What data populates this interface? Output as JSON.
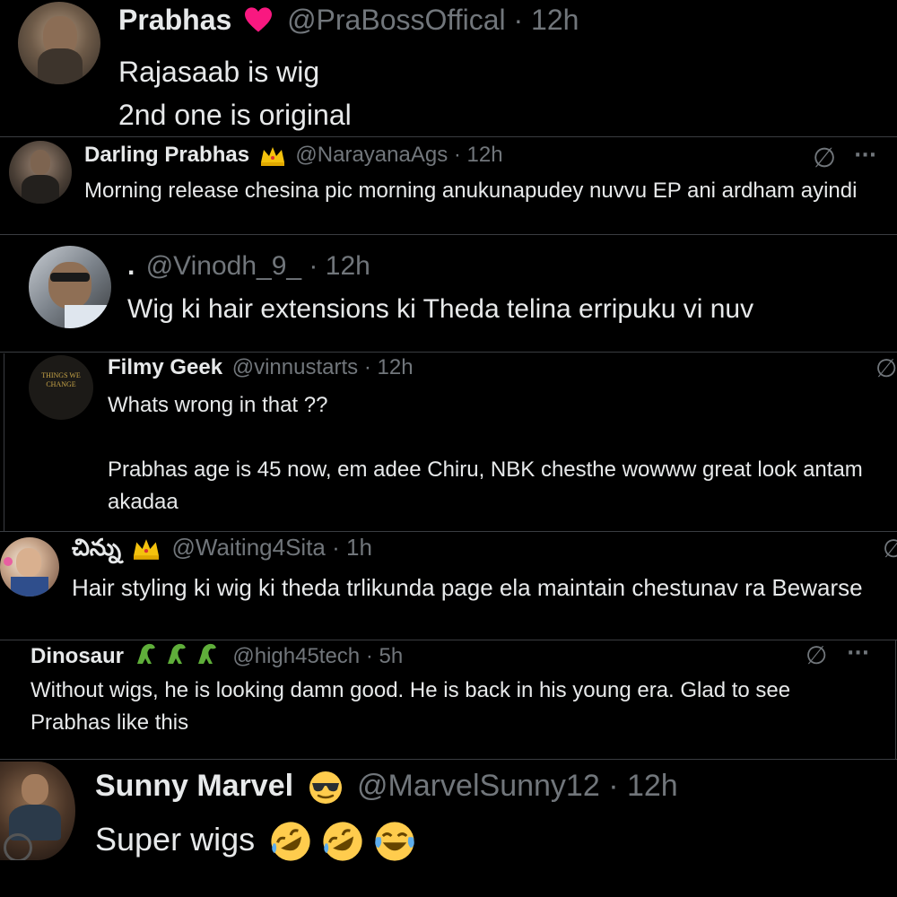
{
  "tweets": [
    {
      "name": "Prabhas",
      "handle": "@PraBossOffical",
      "time": "12h",
      "sep": "·",
      "lines": [
        "Rajasaab is wig",
        "2nd one is original"
      ]
    },
    {
      "name": "Darling Prabhas",
      "handle": "@NarayanaAgs",
      "time": "12h",
      "sep": "·",
      "text": "Morning release chesina pic morning anukunapudey nuvvu EP ani ardham ayindi"
    },
    {
      "name": ".",
      "handle": "@Vinodh_9_",
      "time": "12h",
      "sep": "·",
      "text": "Wig ki hair extensions ki Theda telina erripuku vi nuv"
    },
    {
      "name": "Filmy Geek",
      "handle": "@vinnustarts",
      "time": "12h",
      "sep": "·",
      "lines": [
        "Whats wrong in that ??",
        "",
        "Prabhas age is 45 now, em adee Chiru, NBK chesthe wowww great look antam akadaa"
      ],
      "avatar_text": "THINGS WE CHANGE"
    },
    {
      "name": "చిన్ను",
      "handle": "@Waiting4Sita",
      "time": "1h",
      "sep": "·",
      "text": "Hair styling ki wig ki theda trlikunda page ela maintain chestunav ra Bewarse"
    },
    {
      "name": "Dinosaur",
      "handle": "@high45tech",
      "time": "5h",
      "sep": "·",
      "text": "Without wigs, he is looking damn good. He is back in his young era. Glad to see Prabhas like this"
    },
    {
      "name": "Sunny Marvel",
      "handle": "@MarvelSunny12",
      "time": "12h",
      "sep": "·",
      "text": "Super wigs"
    }
  ],
  "icons": {
    "grok": "∅",
    "more": "···"
  },
  "colors": {
    "bg": "#000000",
    "text": "#e7e9ea",
    "muted": "#71767b",
    "heart": "#f91880",
    "gold": "#f4c20d",
    "emoji": "#ffcc4d"
  }
}
